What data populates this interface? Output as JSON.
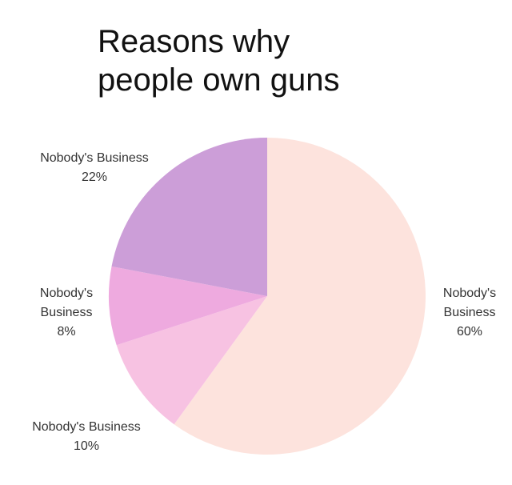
{
  "chart_data": {
    "type": "pie",
    "title_lines": [
      "Reasons why",
      "people own guns"
    ],
    "slices": [
      {
        "label": "Nobody's Business",
        "value": 60,
        "display": "60%",
        "color": "#fde3dd",
        "label_lines": [
          "Nobody's",
          "Business"
        ]
      },
      {
        "label": "Nobody's Business",
        "value": 10,
        "display": "10%",
        "color": "#f7c2e2",
        "label_lines": [
          "Nobody's Business"
        ]
      },
      {
        "label": "Nobody's Business",
        "value": 8,
        "display": "8%",
        "color": "#eeaadf",
        "label_lines": [
          "Nobody's",
          "Business"
        ]
      },
      {
        "label": "Nobody's Business",
        "value": 22,
        "display": "22%",
        "color": "#cc9ed8",
        "label_lines": [
          "Nobody's Business"
        ]
      }
    ],
    "start_angle_deg": 0,
    "direction": "clockwise",
    "legend": "none"
  }
}
